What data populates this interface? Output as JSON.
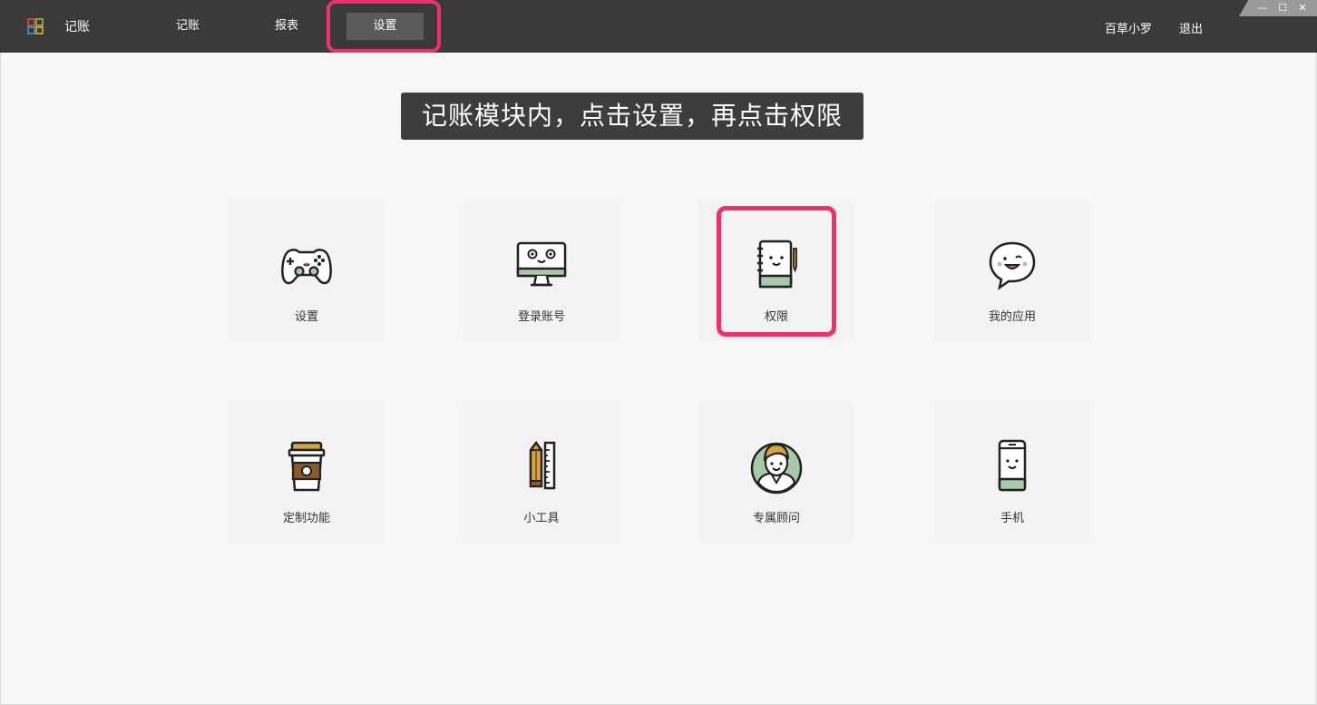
{
  "header": {
    "app_title": "记账",
    "nav": [
      {
        "label": "记账"
      },
      {
        "label": "报表"
      },
      {
        "label": "设置"
      }
    ],
    "user_name": "百草小罗",
    "logout_label": "退出"
  },
  "window_controls": {
    "minimize": "—",
    "maximize": "☐",
    "close": "✕"
  },
  "instruction": "记账模块内，点击设置，再点击权限",
  "tiles": [
    {
      "label": "设置",
      "icon": "gamepad-icon"
    },
    {
      "label": "登录账号",
      "icon": "monitor-icon"
    },
    {
      "label": "权限",
      "icon": "notebook-icon"
    },
    {
      "label": "我的应用",
      "icon": "chat-bubble-icon"
    },
    {
      "label": "定制功能",
      "icon": "coffee-cup-icon"
    },
    {
      "label": "小工具",
      "icon": "pencil-ruler-icon"
    },
    {
      "label": "专属顾问",
      "icon": "advisor-icon"
    },
    {
      "label": "手机",
      "icon": "phone-icon"
    }
  ],
  "colors": {
    "highlight": "#f0306c",
    "topbar": "#3a3a3a",
    "icon_green": "#a6c9a8",
    "icon_brown": "#8b5a2b",
    "icon_gold": "#d9a441"
  }
}
